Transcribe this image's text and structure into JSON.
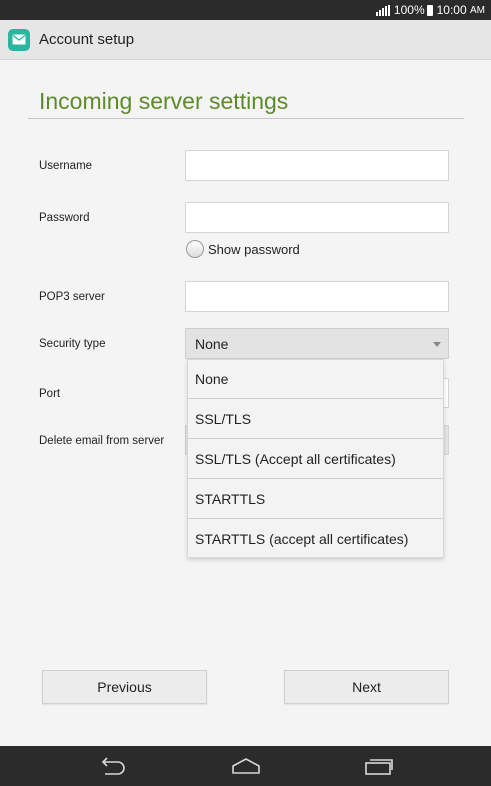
{
  "status_bar": {
    "battery_percent": "100%",
    "time": "10:00",
    "time_suffix": "AM"
  },
  "action_bar": {
    "title": "Account setup",
    "icon": "email-icon"
  },
  "page": {
    "title": "Incoming server settings",
    "accent_color": "#5e8a2b"
  },
  "form": {
    "username_label": "Username",
    "username_value": "",
    "password_label": "Password",
    "password_value": "",
    "show_password_label": "Show password",
    "pop3_label": "POP3 server",
    "pop3_value": "",
    "security_type_label": "Security type",
    "security_type_value": "None",
    "port_label": "Port",
    "delete_email_label": "Delete email from server"
  },
  "security_options": [
    "None",
    "SSL/TLS",
    "SSL/TLS (Accept all certificates)",
    "STARTTLS",
    "STARTTLS (accept all certificates)"
  ],
  "buttons": {
    "previous": "Previous",
    "next": "Next"
  },
  "nav": {
    "back": "back-icon",
    "home": "home-icon",
    "recents": "recents-icon"
  }
}
